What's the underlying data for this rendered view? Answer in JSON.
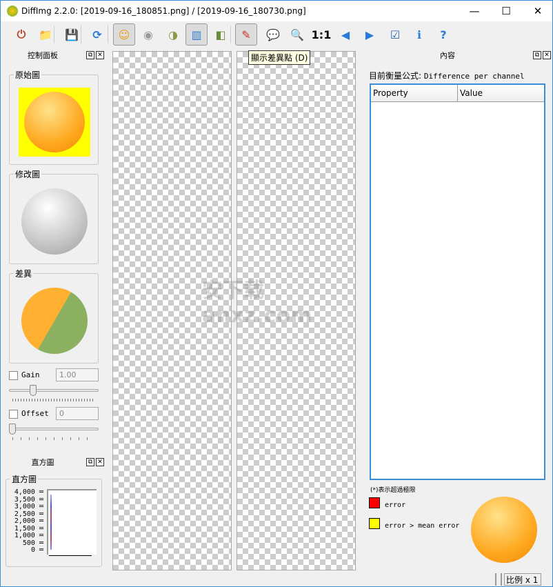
{
  "window": {
    "title": "DiffImg 2.2.0: [2019-09-16_180851.png] / [2019-09-16_180730.png]",
    "minimize": "—",
    "maximize": "☐",
    "close": "✕"
  },
  "toolbar": {
    "items": [
      {
        "icon": "power-icon",
        "glyph": "⏻",
        "color": "#b8472c",
        "active": false
      },
      {
        "icon": "folder-open-icon",
        "glyph": "📁",
        "color": "#e8c84a",
        "active": false
      },
      {
        "icon": "save-icon",
        "glyph": "💾",
        "color": "#2a5fa8",
        "active": false
      },
      {
        "icon": "refresh-icon",
        "glyph": "⟳",
        "color": "#2a7ad8",
        "active": false
      },
      {
        "icon": "original-image-icon",
        "glyph": "☺",
        "color": "#f09a10",
        "active": true
      },
      {
        "icon": "modified-image-icon",
        "glyph": "◉",
        "color": "#999",
        "active": false
      },
      {
        "icon": "difference-image-icon",
        "glyph": "◑",
        "color": "#8a9a40",
        "active": false
      },
      {
        "icon": "dual-panel-icon",
        "glyph": "▥",
        "color": "#2a7ad8",
        "active": true
      },
      {
        "icon": "split-view-icon",
        "glyph": "◧",
        "color": "#6a8a40",
        "active": false
      },
      {
        "icon": "show-diff-points-icon",
        "glyph": "✎",
        "color": "#d03020",
        "active": true
      },
      {
        "icon": "comment-icon",
        "glyph": "💬",
        "color": "#9ab",
        "active": false
      },
      {
        "icon": "zoom-fit-icon",
        "glyph": "🔍",
        "color": "#2a7ad8",
        "active": false
      },
      {
        "icon": "zoom-1to1-icon",
        "glyph": "1:1",
        "color": "#000",
        "active": false
      },
      {
        "icon": "previous-icon",
        "glyph": "◀",
        "color": "#2a7ad8",
        "active": false
      },
      {
        "icon": "next-icon",
        "glyph": "▶",
        "color": "#2a7ad8",
        "active": false
      },
      {
        "icon": "checklist-icon",
        "glyph": "☑",
        "color": "#2a5fa8",
        "active": false
      },
      {
        "icon": "info-icon",
        "glyph": "ℹ",
        "color": "#2a7ad8",
        "active": false
      },
      {
        "icon": "help-icon",
        "glyph": "?",
        "color": "#2a7ad8",
        "active": false
      }
    ],
    "tooltip": "顯示差異點 (D)"
  },
  "control_panel": {
    "title": "控制面板",
    "original_label": "原始圖",
    "modified_label": "修改圖",
    "diff_label": "差異",
    "gain_label": "Gain",
    "gain_value": "1.00",
    "gain_slider": 0.3,
    "offset_label": "Offset",
    "offset_value": "0",
    "offset_slider": 0
  },
  "histogram_panel": {
    "title": "直方圖",
    "group_label": "直方圖",
    "y_ticks": [
      "4,000",
      "3,500",
      "3,000",
      "2,500",
      "2,000",
      "1,500",
      "1,000",
      "500",
      "0"
    ]
  },
  "content_panel": {
    "title": "內容",
    "metric_label": "目前衡量公式:",
    "metric_value": "Difference per channel",
    "columns": [
      "Property",
      "Value"
    ],
    "legend_note": "(*)表示超過極限",
    "legend": [
      {
        "color": "#ff0000",
        "label": "error"
      },
      {
        "color": "#ffff00",
        "label": "error > mean error"
      }
    ]
  },
  "status": {
    "zoom": "比例 x  1"
  },
  "watermark": "安下载 anxz.com"
}
